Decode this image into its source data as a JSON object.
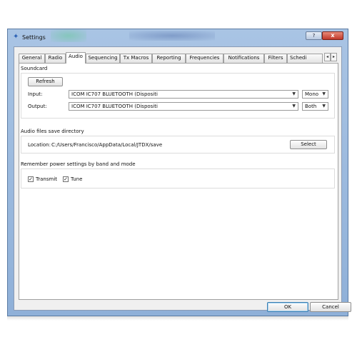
{
  "window": {
    "title": "Settings",
    "help_label": "?",
    "close_label": "x"
  },
  "tabs": [
    {
      "label": "General"
    },
    {
      "label": "Radio"
    },
    {
      "label": "Audio"
    },
    {
      "label": "Sequencing"
    },
    {
      "label": "Tx Macros"
    },
    {
      "label": "Reporting"
    },
    {
      "label": "Frequencies"
    },
    {
      "label": "Notifications"
    },
    {
      "label": "Filters"
    },
    {
      "label": "Schedi"
    }
  ],
  "active_tab": "Audio",
  "tab_scroll": {
    "left": "◂",
    "right": "▸"
  },
  "soundcard": {
    "title": "Soundcard",
    "refresh_label": "Refresh",
    "input_label": "Input:",
    "input_value": "ICOM IC707 BLUETOOTH (Dispositi",
    "input_channel": "Mono",
    "output_label": "Output:",
    "output_value": "ICOM IC707 BLUETOOTH (Dispositi",
    "output_channel": "Both"
  },
  "save_dir": {
    "title": "Audio files save directory",
    "location_label": "Location:",
    "location_value": "C:/Users/Francisco/AppData/Local/JTDX/save",
    "select_label": "Select"
  },
  "power": {
    "title": "Remember power settings by band and mode",
    "transmit_label": "Transmit",
    "transmit_checked": "✓",
    "tune_label": "Tune",
    "tune_checked": "✓"
  },
  "dialog": {
    "ok_label": "OK",
    "cancel_label": "Cancel"
  },
  "icons": {
    "app": "✦",
    "dropdown": "▼"
  }
}
